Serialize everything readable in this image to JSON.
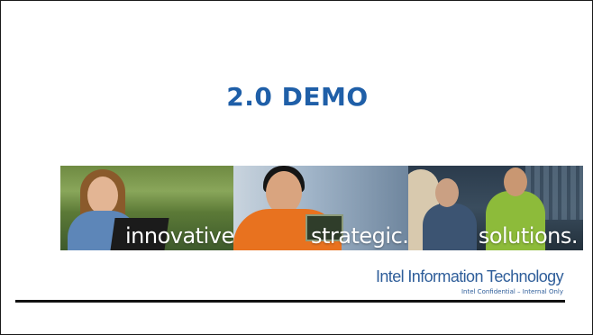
{
  "slide": {
    "title": "2.0 DEMO",
    "banner": {
      "panels": [
        {
          "tagline": "innovative."
        },
        {
          "tagline": "strategic."
        },
        {
          "tagline": "solutions."
        }
      ]
    },
    "branding": {
      "name": "Intel Information Technology",
      "confidentiality": "Intel Confidential – Internal Only"
    }
  },
  "colors": {
    "title": "#1f5fa8",
    "brand": "#2f5e9a",
    "rule": "#111111",
    "background": "#ffffff"
  }
}
